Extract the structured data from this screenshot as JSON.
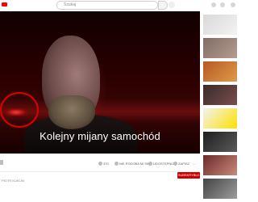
{
  "search": {
    "placeholder": "Szukaj"
  },
  "video": {
    "subtitle": "Kolejny mijany samochód"
  },
  "actions": {
    "like_count": "370",
    "dislike": "NIE PODOBA MI SIĘ",
    "share": "UDOSTĘPNIJ",
    "save": "ZAPISZ",
    "more": "..."
  },
  "channel": {
    "name": "PIOTR KUKLIN"
  },
  "subscribe_label": "SUBSKRYBUJ",
  "colors": {
    "brand": "#ff0000",
    "subscribe": "#cc0000",
    "highlight": "#e00000"
  }
}
